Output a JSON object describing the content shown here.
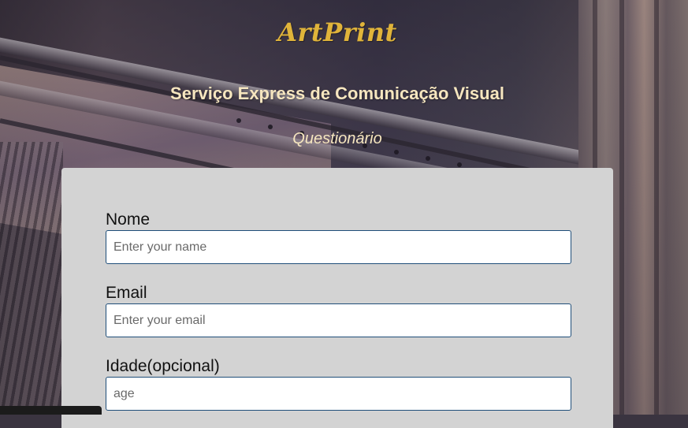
{
  "header": {
    "logo": "ArtPrint",
    "subtitle": "Serviço Express de Comunicação Visual",
    "description": "Questionário"
  },
  "form": {
    "fields": [
      {
        "label": "Nome",
        "placeholder": "Enter your name",
        "value": ""
      },
      {
        "label": "Email",
        "placeholder": "Enter your email",
        "value": ""
      },
      {
        "label": "Idade(opcional)",
        "placeholder": "age",
        "value": ""
      }
    ]
  },
  "colors": {
    "logo": "#e0b43a",
    "heading": "#f6e6bf",
    "card": "#d3d3d3",
    "input_border": "#1f4e79"
  }
}
